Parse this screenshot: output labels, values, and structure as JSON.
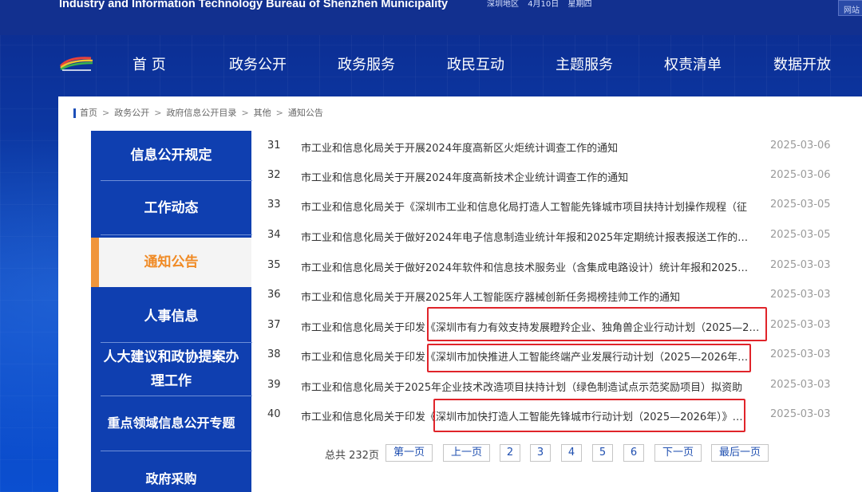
{
  "header": {
    "site_title": "Industry and Information Technology Bureau of Shenzhen Municipality",
    "region": "深圳地区",
    "date": "4月10日",
    "weekday": "星期四",
    "net_label": "网站"
  },
  "nav": {
    "items": [
      "首 页",
      "政务公开",
      "政务服务",
      "政民互动",
      "主题服务",
      "权责清单",
      "数据开放"
    ]
  },
  "breadcrumb": {
    "items": [
      "首页",
      "政务公开",
      "政府信息公开目录",
      "其他",
      "通知公告"
    ],
    "separator": ">"
  },
  "sidebar": {
    "items": [
      {
        "label": "信息公开规定"
      },
      {
        "label": "工作动态"
      },
      {
        "label": "通知公告",
        "active": true
      },
      {
        "label": "人事信息"
      },
      {
        "label": "人大建议和政协提案办理工作"
      },
      {
        "label": "重点领域信息公开专题"
      },
      {
        "label": "政府采购"
      }
    ]
  },
  "list": {
    "rows": [
      {
        "num": "31",
        "title": "市工业和信息化局关于开展2024年度高新区火炬统计调查工作的通知",
        "date": "2025-03-06"
      },
      {
        "num": "32",
        "title": "市工业和信息化局关于开展2024年度高新技术企业统计调查工作的通知",
        "date": "2025-03-06"
      },
      {
        "num": "33",
        "title": "市工业和信息化局关于《深圳市工业和信息化局打造人工智能先锋城市项目扶持计划操作规程（征",
        "date": "2025-03-05"
      },
      {
        "num": "34",
        "title": "市工业和信息化局关于做好2024年电子信息制造业统计年报和2025年定期统计报表报送工作的…",
        "date": "2025-03-05"
      },
      {
        "num": "35",
        "title": "市工业和信息化局关于做好2024年软件和信息技术服务业（含集成电路设计）统计年报和2025…",
        "date": "2025-03-03"
      },
      {
        "num": "36",
        "title": "市工业和信息化局关于开展2025年人工智能医疗器械创新任务揭榜挂帅工作的通知",
        "date": "2025-03-03"
      },
      {
        "num": "37",
        "title": "市工业和信息化局关于印发《深圳市有力有效支持发展瞪羚企业、独角兽企业行动计划（2025—2…",
        "date": "2025-03-03"
      },
      {
        "num": "38",
        "title": "市工业和信息化局关于印发《深圳市加快推进人工智能终端产业发展行动计划（2025—2026年…",
        "date": "2025-03-03"
      },
      {
        "num": "39",
        "title": "市工业和信息化局关于2025年企业技术改造项目扶持计划（绿色制造试点示范奖励项目）拟资助",
        "date": "2025-03-03"
      },
      {
        "num": "40",
        "title": "市工业和信息化局关于印发《深圳市加快打造人工智能先锋城市行动计划（2025—2026年）》…",
        "date": "2025-03-03"
      }
    ]
  },
  "pager": {
    "total": "总共 232页",
    "first": "第一页",
    "prev": "上一页",
    "pages": [
      "2",
      "3",
      "4",
      "5",
      "6"
    ],
    "next": "下一页",
    "last": "最后一页"
  },
  "colors": {
    "highlight_box": "#e0242a",
    "sidebar_bg": "#0f3fb0",
    "active_accent": "#f08a24"
  }
}
